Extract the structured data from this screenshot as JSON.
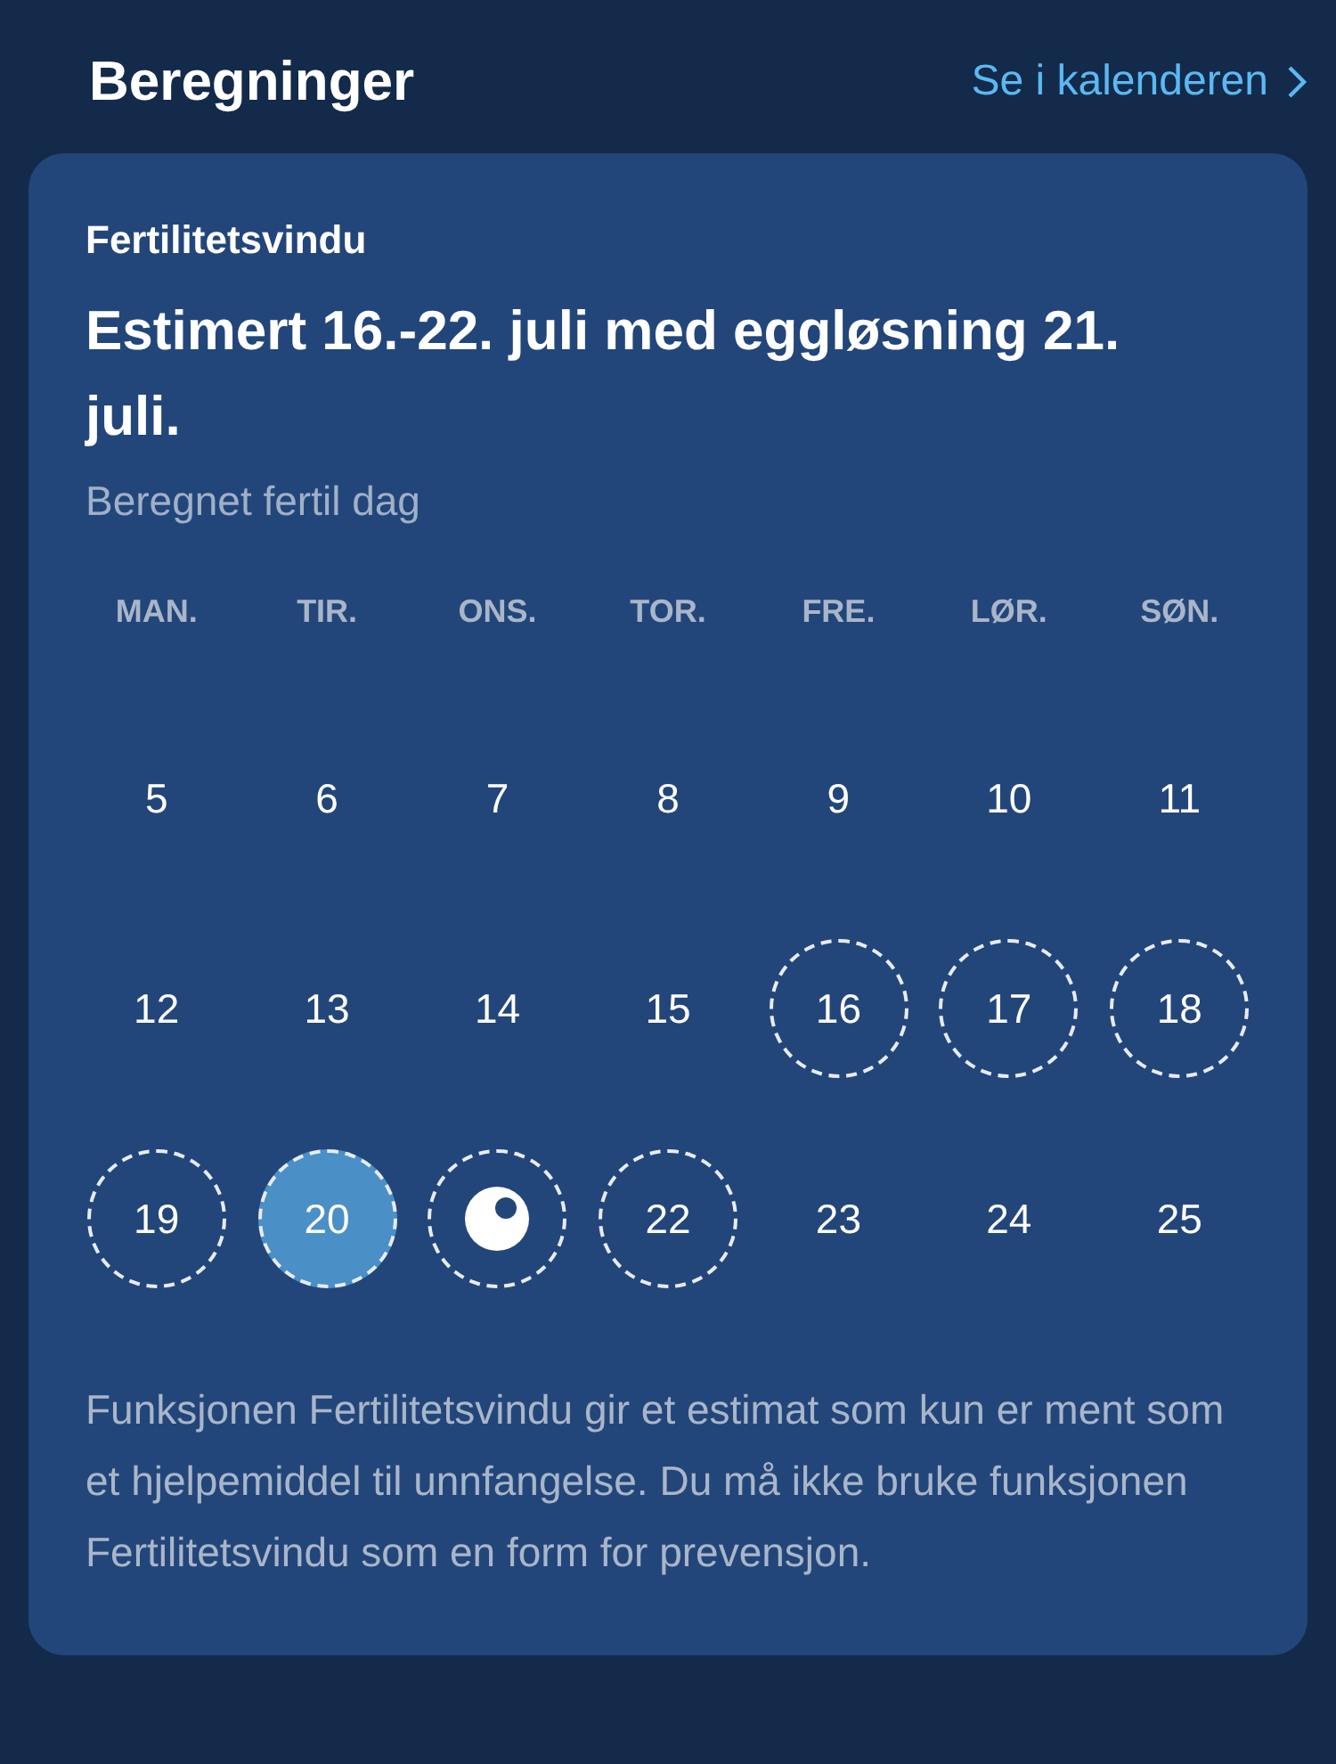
{
  "header": {
    "title": "Beregninger",
    "link": "Se i kalenderen"
  },
  "card": {
    "label": "Fertilitetsvindu",
    "headline": "Estimert 16.-22. juli med eggløsning 21. juli.",
    "legend": "Beregnet fertil dag",
    "weekdays": [
      "MAN.",
      "TIR.",
      "ONS.",
      "TOR.",
      "FRE.",
      "LØR.",
      "SØN."
    ],
    "weeks": [
      [
        {
          "label": "5",
          "kind": "plain",
          "selected": false
        },
        {
          "label": "6",
          "kind": "plain",
          "selected": false
        },
        {
          "label": "7",
          "kind": "plain",
          "selected": false
        },
        {
          "label": "8",
          "kind": "plain",
          "selected": false
        },
        {
          "label": "9",
          "kind": "plain",
          "selected": false
        },
        {
          "label": "10",
          "kind": "plain",
          "selected": false
        },
        {
          "label": "11",
          "kind": "plain",
          "selected": false
        }
      ],
      [
        {
          "label": "12",
          "kind": "plain",
          "selected": false
        },
        {
          "label": "13",
          "kind": "plain",
          "selected": false
        },
        {
          "label": "14",
          "kind": "plain",
          "selected": false
        },
        {
          "label": "15",
          "kind": "plain",
          "selected": false
        },
        {
          "label": "16",
          "kind": "fertile",
          "selected": false
        },
        {
          "label": "17",
          "kind": "fertile",
          "selected": false
        },
        {
          "label": "18",
          "kind": "fertile",
          "selected": false
        }
      ],
      [
        {
          "label": "19",
          "kind": "fertile",
          "selected": false
        },
        {
          "label": "20",
          "kind": "fertile",
          "selected": true
        },
        {
          "kind": "ovulation",
          "selected": false
        },
        {
          "label": "22",
          "kind": "fertile",
          "selected": false
        },
        {
          "label": "23",
          "kind": "plain",
          "selected": false
        },
        {
          "label": "24",
          "kind": "plain",
          "selected": false
        },
        {
          "label": "25",
          "kind": "plain",
          "selected": false
        }
      ]
    ],
    "disclaimer": "Funksjonen Fertilitetsvindu gir et estimat som kun er ment som et hjelpemiddel til unnfangelse. Du må ikke bruke funksjonen Fertilitetsvindu som en form for prevensjon."
  }
}
